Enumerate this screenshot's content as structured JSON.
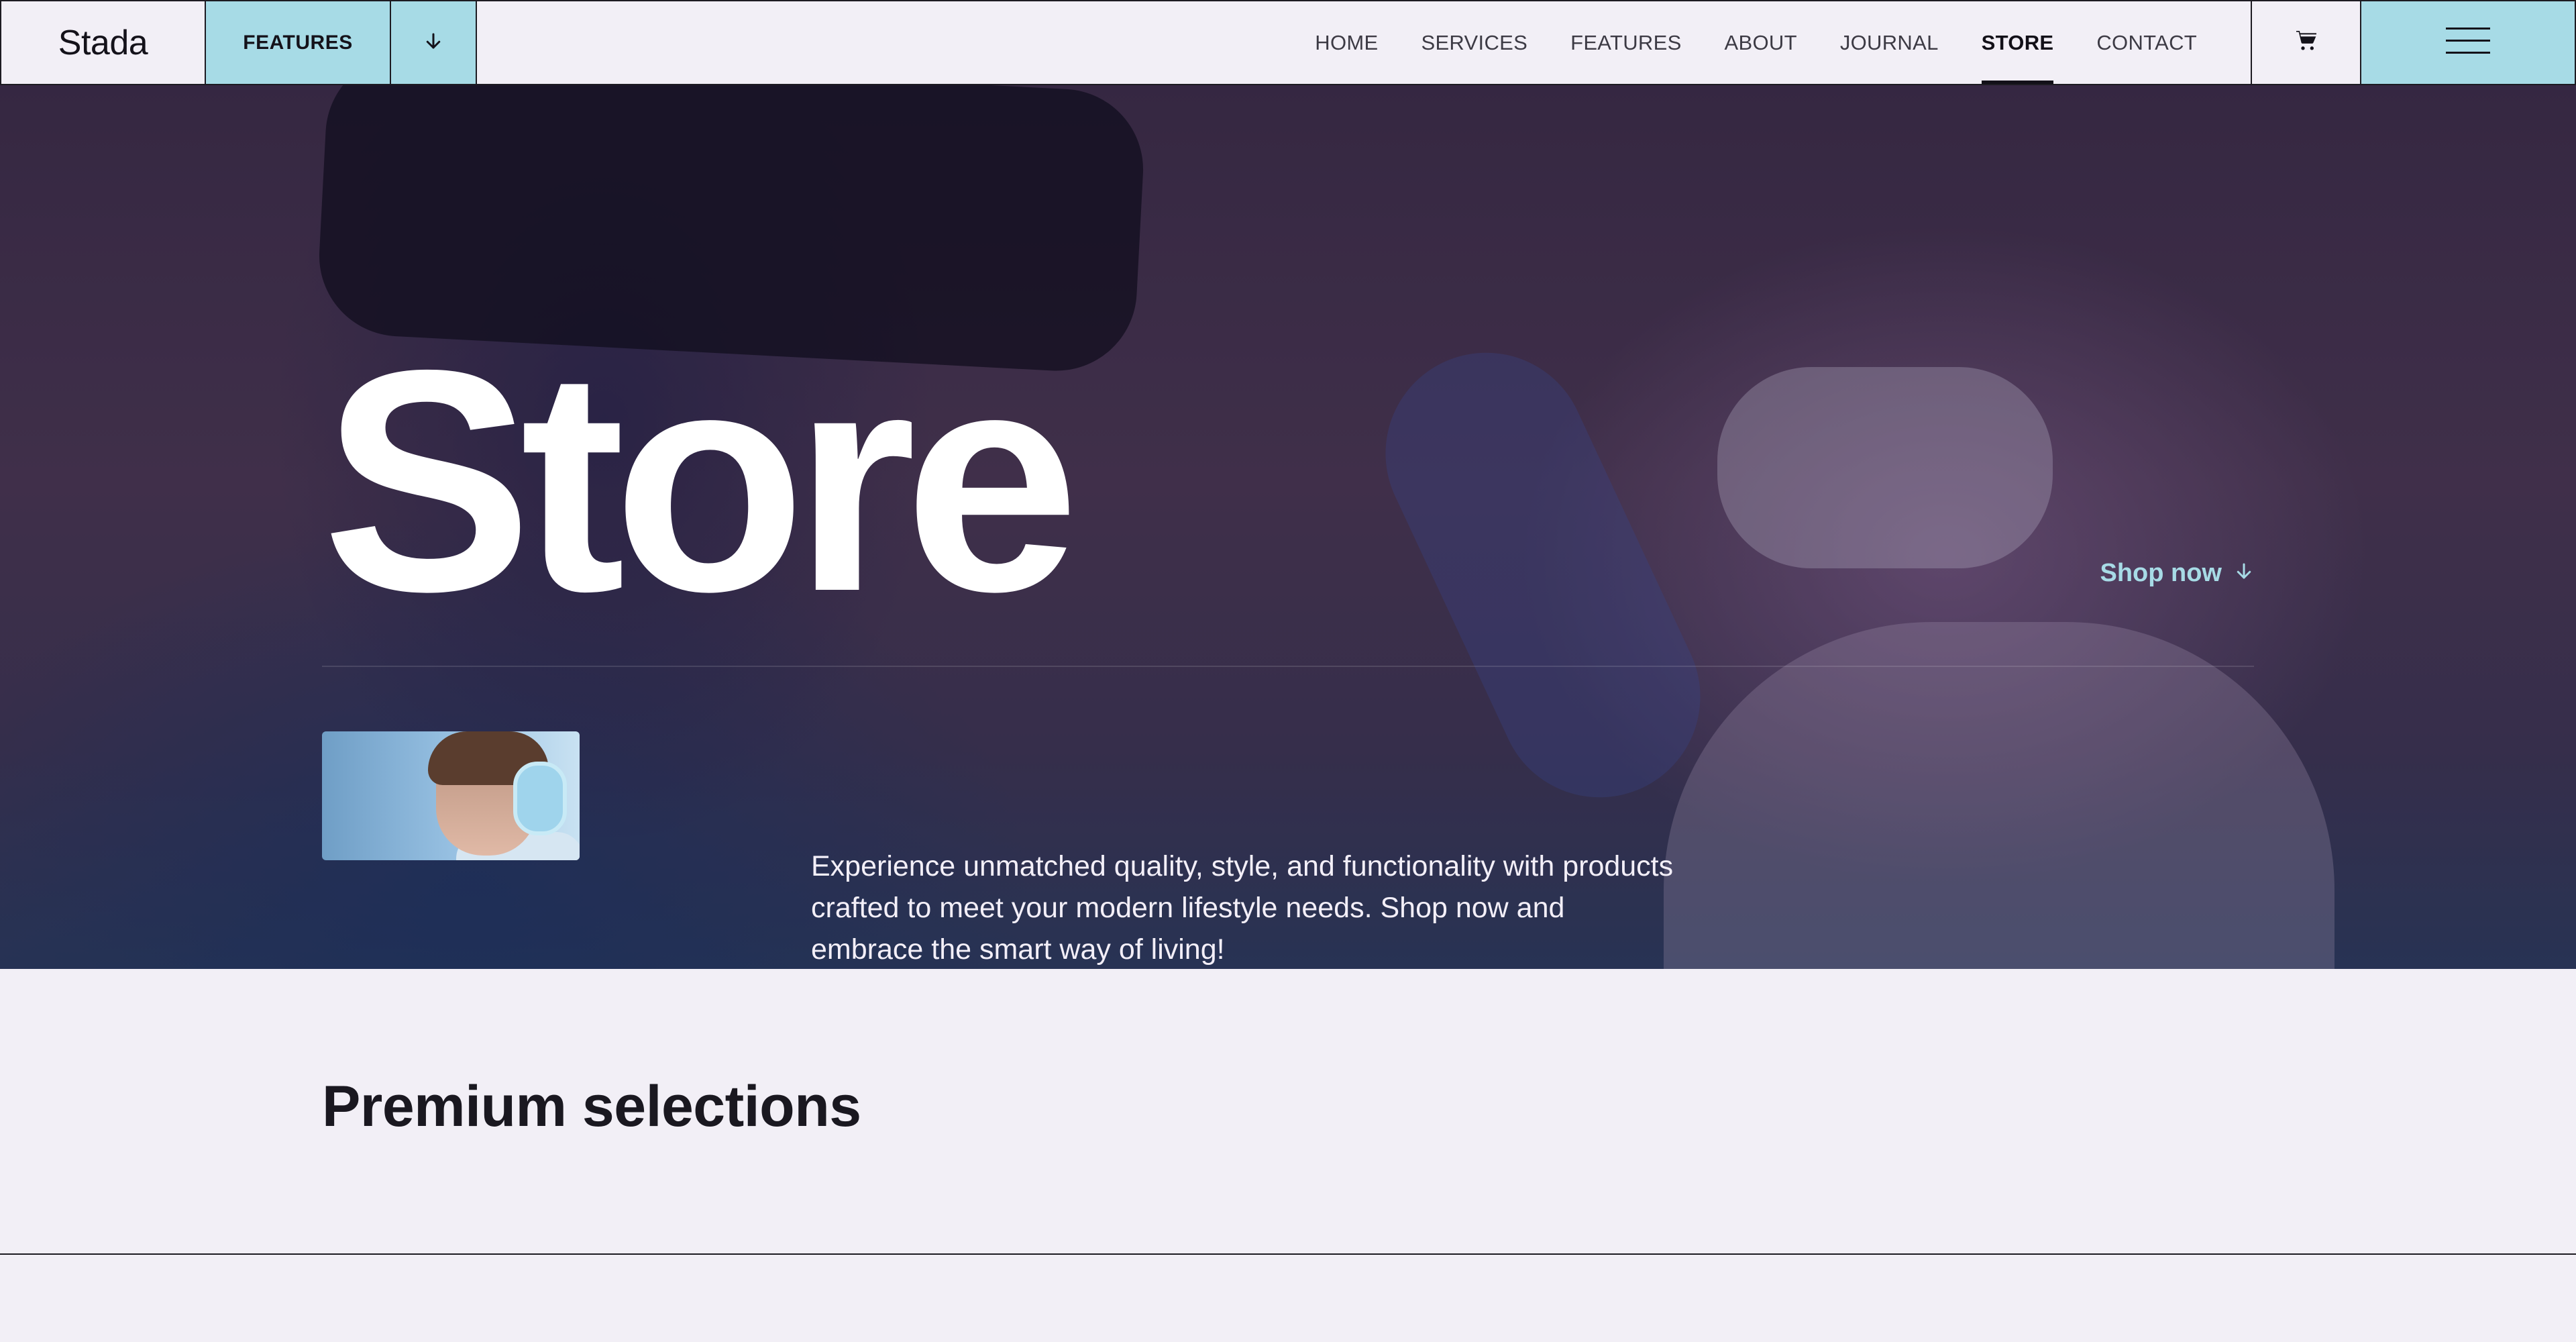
{
  "header": {
    "logo": "Stada",
    "features_button": "FEATURES",
    "nav": [
      {
        "label": "HOME",
        "active": false
      },
      {
        "label": "SERVICES",
        "active": false
      },
      {
        "label": "FEATURES",
        "active": false
      },
      {
        "label": "ABOUT",
        "active": false
      },
      {
        "label": "JOURNAL",
        "active": false
      },
      {
        "label": "STORE",
        "active": true
      },
      {
        "label": "CONTACT",
        "active": false
      }
    ],
    "icons": {
      "features_arrow": "arrow-down-icon",
      "cart": "cart-icon",
      "menu": "hamburger-menu-icon"
    }
  },
  "hero": {
    "title": "Store",
    "cta": "Shop now",
    "description": "Experience unmatched quality, style, and functionality with products crafted to meet your modern lifestyle needs. Shop now and embrace the smart way of living!"
  },
  "section": {
    "title": "Premium selections"
  },
  "colors": {
    "accent": "#a7dbe6",
    "page_background": "#f2eff6",
    "text_dark": "#16141d"
  }
}
